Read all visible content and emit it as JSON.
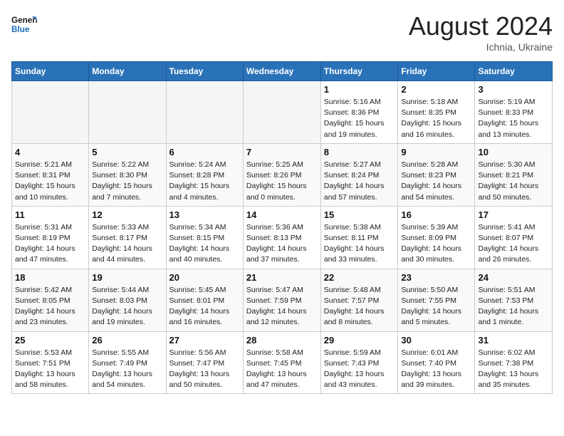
{
  "header": {
    "logo_general": "General",
    "logo_blue": "Blue",
    "month_year": "August 2024",
    "location": "Ichnia, Ukraine"
  },
  "weekdays": [
    "Sunday",
    "Monday",
    "Tuesday",
    "Wednesday",
    "Thursday",
    "Friday",
    "Saturday"
  ],
  "weeks": [
    [
      {
        "day": "",
        "info": ""
      },
      {
        "day": "",
        "info": ""
      },
      {
        "day": "",
        "info": ""
      },
      {
        "day": "",
        "info": ""
      },
      {
        "day": "1",
        "info": "Sunrise: 5:16 AM\nSunset: 8:36 PM\nDaylight: 15 hours\nand 19 minutes."
      },
      {
        "day": "2",
        "info": "Sunrise: 5:18 AM\nSunset: 8:35 PM\nDaylight: 15 hours\nand 16 minutes."
      },
      {
        "day": "3",
        "info": "Sunrise: 5:19 AM\nSunset: 8:33 PM\nDaylight: 15 hours\nand 13 minutes."
      }
    ],
    [
      {
        "day": "4",
        "info": "Sunrise: 5:21 AM\nSunset: 8:31 PM\nDaylight: 15 hours\nand 10 minutes."
      },
      {
        "day": "5",
        "info": "Sunrise: 5:22 AM\nSunset: 8:30 PM\nDaylight: 15 hours\nand 7 minutes."
      },
      {
        "day": "6",
        "info": "Sunrise: 5:24 AM\nSunset: 8:28 PM\nDaylight: 15 hours\nand 4 minutes."
      },
      {
        "day": "7",
        "info": "Sunrise: 5:25 AM\nSunset: 8:26 PM\nDaylight: 15 hours\nand 0 minutes."
      },
      {
        "day": "8",
        "info": "Sunrise: 5:27 AM\nSunset: 8:24 PM\nDaylight: 14 hours\nand 57 minutes."
      },
      {
        "day": "9",
        "info": "Sunrise: 5:28 AM\nSunset: 8:23 PM\nDaylight: 14 hours\nand 54 minutes."
      },
      {
        "day": "10",
        "info": "Sunrise: 5:30 AM\nSunset: 8:21 PM\nDaylight: 14 hours\nand 50 minutes."
      }
    ],
    [
      {
        "day": "11",
        "info": "Sunrise: 5:31 AM\nSunset: 8:19 PM\nDaylight: 14 hours\nand 47 minutes."
      },
      {
        "day": "12",
        "info": "Sunrise: 5:33 AM\nSunset: 8:17 PM\nDaylight: 14 hours\nand 44 minutes."
      },
      {
        "day": "13",
        "info": "Sunrise: 5:34 AM\nSunset: 8:15 PM\nDaylight: 14 hours\nand 40 minutes."
      },
      {
        "day": "14",
        "info": "Sunrise: 5:36 AM\nSunset: 8:13 PM\nDaylight: 14 hours\nand 37 minutes."
      },
      {
        "day": "15",
        "info": "Sunrise: 5:38 AM\nSunset: 8:11 PM\nDaylight: 14 hours\nand 33 minutes."
      },
      {
        "day": "16",
        "info": "Sunrise: 5:39 AM\nSunset: 8:09 PM\nDaylight: 14 hours\nand 30 minutes."
      },
      {
        "day": "17",
        "info": "Sunrise: 5:41 AM\nSunset: 8:07 PM\nDaylight: 14 hours\nand 26 minutes."
      }
    ],
    [
      {
        "day": "18",
        "info": "Sunrise: 5:42 AM\nSunset: 8:05 PM\nDaylight: 14 hours\nand 23 minutes."
      },
      {
        "day": "19",
        "info": "Sunrise: 5:44 AM\nSunset: 8:03 PM\nDaylight: 14 hours\nand 19 minutes."
      },
      {
        "day": "20",
        "info": "Sunrise: 5:45 AM\nSunset: 8:01 PM\nDaylight: 14 hours\nand 16 minutes."
      },
      {
        "day": "21",
        "info": "Sunrise: 5:47 AM\nSunset: 7:59 PM\nDaylight: 14 hours\nand 12 minutes."
      },
      {
        "day": "22",
        "info": "Sunrise: 5:48 AM\nSunset: 7:57 PM\nDaylight: 14 hours\nand 8 minutes."
      },
      {
        "day": "23",
        "info": "Sunrise: 5:50 AM\nSunset: 7:55 PM\nDaylight: 14 hours\nand 5 minutes."
      },
      {
        "day": "24",
        "info": "Sunrise: 5:51 AM\nSunset: 7:53 PM\nDaylight: 14 hours\nand 1 minute."
      }
    ],
    [
      {
        "day": "25",
        "info": "Sunrise: 5:53 AM\nSunset: 7:51 PM\nDaylight: 13 hours\nand 58 minutes."
      },
      {
        "day": "26",
        "info": "Sunrise: 5:55 AM\nSunset: 7:49 PM\nDaylight: 13 hours\nand 54 minutes."
      },
      {
        "day": "27",
        "info": "Sunrise: 5:56 AM\nSunset: 7:47 PM\nDaylight: 13 hours\nand 50 minutes."
      },
      {
        "day": "28",
        "info": "Sunrise: 5:58 AM\nSunset: 7:45 PM\nDaylight: 13 hours\nand 47 minutes."
      },
      {
        "day": "29",
        "info": "Sunrise: 5:59 AM\nSunset: 7:43 PM\nDaylight: 13 hours\nand 43 minutes."
      },
      {
        "day": "30",
        "info": "Sunrise: 6:01 AM\nSunset: 7:40 PM\nDaylight: 13 hours\nand 39 minutes."
      },
      {
        "day": "31",
        "info": "Sunrise: 6:02 AM\nSunset: 7:38 PM\nDaylight: 13 hours\nand 35 minutes."
      }
    ]
  ]
}
